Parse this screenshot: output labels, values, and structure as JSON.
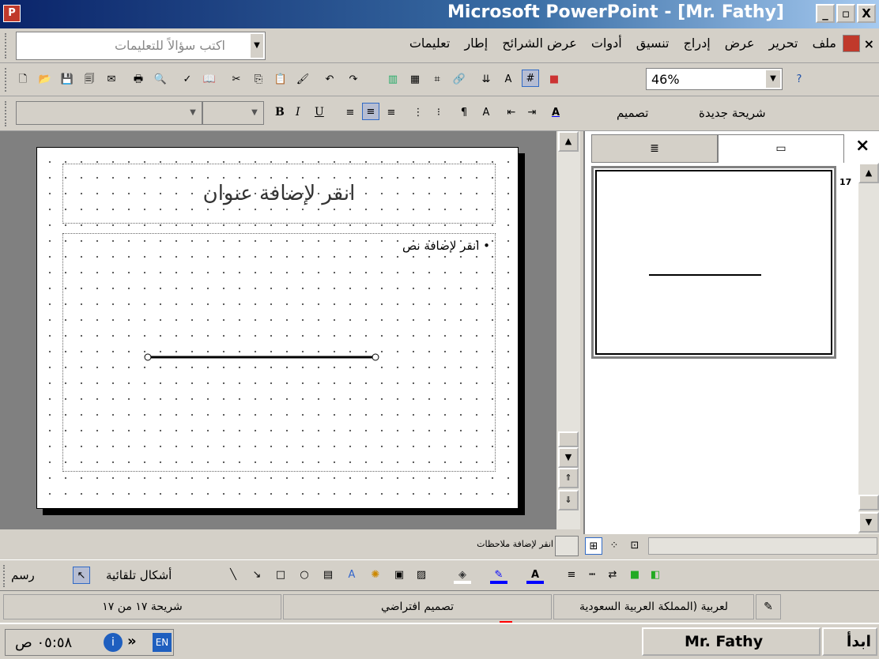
{
  "window": {
    "title": "Microsoft PowerPoint - [Mr. Fathy]",
    "controls": {
      "minimize": "_",
      "maximize": "▫",
      "close": "X"
    }
  },
  "menubar": {
    "close_doc": "×",
    "items": [
      "ملف",
      "تحرير",
      "عرض",
      "إدراج",
      "تنسيق",
      "أدوات",
      "عرض الشرائح",
      "إطار",
      "تعليمات"
    ],
    "help_placeholder": "اكتب سؤالاً للتعليمات"
  },
  "standard_toolbar": {
    "zoom": "46%"
  },
  "formatting_toolbar": {
    "new_slide": "شريحة جديدة",
    "design": "تصميم",
    "bold": "B",
    "italic": "I",
    "underline": "U"
  },
  "slide": {
    "title_placeholder": "انقر لإضافة عنوان",
    "body_placeholder": "انقر لإضافة نص"
  },
  "slides_pane": {
    "slide_number": "17",
    "close": "×"
  },
  "notes": {
    "placeholder": "انقر لإضافة ملاحظات"
  },
  "drawing_toolbar": {
    "draw": "رسم",
    "autoshapes": "أشكال تلقائية"
  },
  "statusbar": {
    "slide_counter": "شريحة ١٧ من ١٧",
    "design": "تصميم افتراضي",
    "language": "لعربية (المملكة العربية السعودية"
  },
  "taskbar": {
    "start": "ابدأ",
    "task_button": "Mr. Fathy",
    "clock": "٠٥:٥٨ ص",
    "lang": "EN"
  },
  "annotation": {
    "arrow_color": "#ff0000"
  }
}
